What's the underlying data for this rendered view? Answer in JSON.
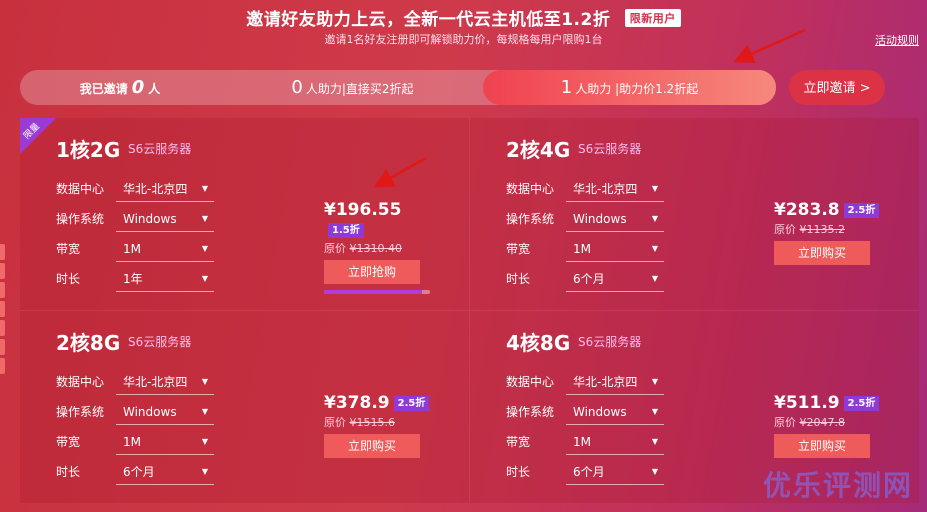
{
  "header": {
    "title": "邀请好友助力上云，全新一代云主机低至1.2折",
    "badge": "限新用户",
    "subtitle": "邀请1名好友注册即可解锁助力价，每规格每用户限购1台",
    "rules_link": "活动规则"
  },
  "progress": {
    "me_prefix": "我已邀请",
    "me_count": "0",
    "me_suffix": "人",
    "seg0_num": "0",
    "seg0_text": "人助力|直接买2折起",
    "seg1_num": "1",
    "seg1_text": "人助力 |助力价1.2折起",
    "invite_button": "立即邀请 >"
  },
  "labels": {
    "datacenter": "数据中心",
    "os": "操作系统",
    "bandwidth": "带宽",
    "duration": "时长",
    "service": "S6云服务器",
    "limit_tag": "限量"
  },
  "products": [
    {
      "spec": "1核2G",
      "datacenter": "华北-北京四",
      "os": "Windows",
      "bandwidth": "1M",
      "duration": "1年",
      "price": "¥196.55",
      "discount": "1.5折",
      "orig_prefix": "原价",
      "orig_price": "¥1310.40",
      "button": "立即抢购",
      "stock_fraction": 0.92
    },
    {
      "spec": "2核4G",
      "datacenter": "华北-北京四",
      "os": "Windows",
      "bandwidth": "1M",
      "duration": "6个月",
      "price": "¥283.8",
      "discount": "2.5折",
      "orig_prefix": "原价",
      "orig_price": "¥1135.2",
      "button": "立即购买"
    },
    {
      "spec": "2核8G",
      "datacenter": "华北-北京四",
      "os": "Windows",
      "bandwidth": "1M",
      "duration": "6个月",
      "price": "¥378.9",
      "discount": "2.5折",
      "orig_prefix": "原价",
      "orig_price": "¥1515.6",
      "button": "立即购买"
    },
    {
      "spec": "4核8G",
      "datacenter": "华北-北京四",
      "os": "Windows",
      "bandwidth": "1M",
      "duration": "6个月",
      "price": "¥511.9",
      "discount": "2.5折",
      "orig_prefix": "原价",
      "orig_price": "¥2047.8",
      "button": "立即购买"
    }
  ],
  "icons": {
    "dropdown": "caret-down-icon",
    "annotation": "red-arrow-icon"
  },
  "colors": {
    "accent": "#ef5a5a",
    "discount_badge": "#8f3ad8",
    "watermark": "#7878ff"
  },
  "watermark": "优乐评测网"
}
